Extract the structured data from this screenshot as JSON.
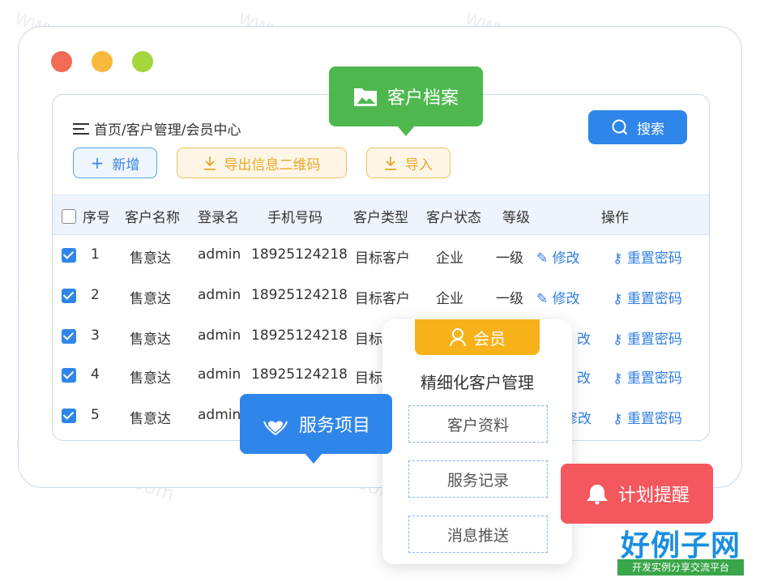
{
  "watermark": {
    "text": "www.haolizi.com"
  },
  "window_dots": {
    "colors": [
      "#f26b55",
      "#f6b93b",
      "#a4d63e"
    ]
  },
  "header": {
    "breadcrumb": "首页/客户管理/会员中心",
    "search_label": "搜索"
  },
  "toolbar": {
    "add_label": "新增",
    "export_qr_label": "导出信息二维码",
    "import_label": "导入"
  },
  "table": {
    "columns": [
      "序号",
      "客户名称",
      "登录名",
      "手机号码",
      "客户类型",
      "客户状态",
      "等级",
      "操作"
    ],
    "rows": [
      {
        "no": "1",
        "name": "售意达",
        "login": "admin",
        "phone": "18925124218",
        "type": "目标客户",
        "status": "企业",
        "level": "一级",
        "edit": "修改",
        "reset": "重置密码"
      },
      {
        "no": "2",
        "name": "售意达",
        "login": "admin",
        "phone": "18925124218",
        "type": "目标客户",
        "status": "企业",
        "level": "一级",
        "edit": "修改",
        "reset": "重置密码"
      },
      {
        "no": "3",
        "name": "售意达",
        "login": "admin",
        "phone": "18925124218",
        "type": "目标",
        "status": "",
        "level": "",
        "edit": "改",
        "reset": "重置密码"
      },
      {
        "no": "4",
        "name": "售意达",
        "login": "admin",
        "phone": "18925124218",
        "type": "目标",
        "status": "",
        "level": "",
        "edit": "改",
        "reset": "重置密码"
      },
      {
        "no": "5",
        "name": "售意达",
        "login": "admin",
        "phone": "",
        "type": "",
        "status": "",
        "level": "",
        "edit": "修改",
        "reset": "重置密码"
      }
    ]
  },
  "callouts": {
    "archive": "客户档案",
    "service": "服务项目",
    "reminder": "计划提醒"
  },
  "member_card": {
    "tag": "会员",
    "title": "精细化客户管理",
    "items": [
      "客户资料",
      "服务记录",
      "消息推送"
    ]
  },
  "brand": {
    "name": "好例子网",
    "slogan": "开发实例分享交流平台"
  },
  "colors": {
    "accent_blue": "#2f86ea",
    "green": "#4eb84f",
    "orange": "#f7b21a",
    "red": "#f4575d"
  }
}
